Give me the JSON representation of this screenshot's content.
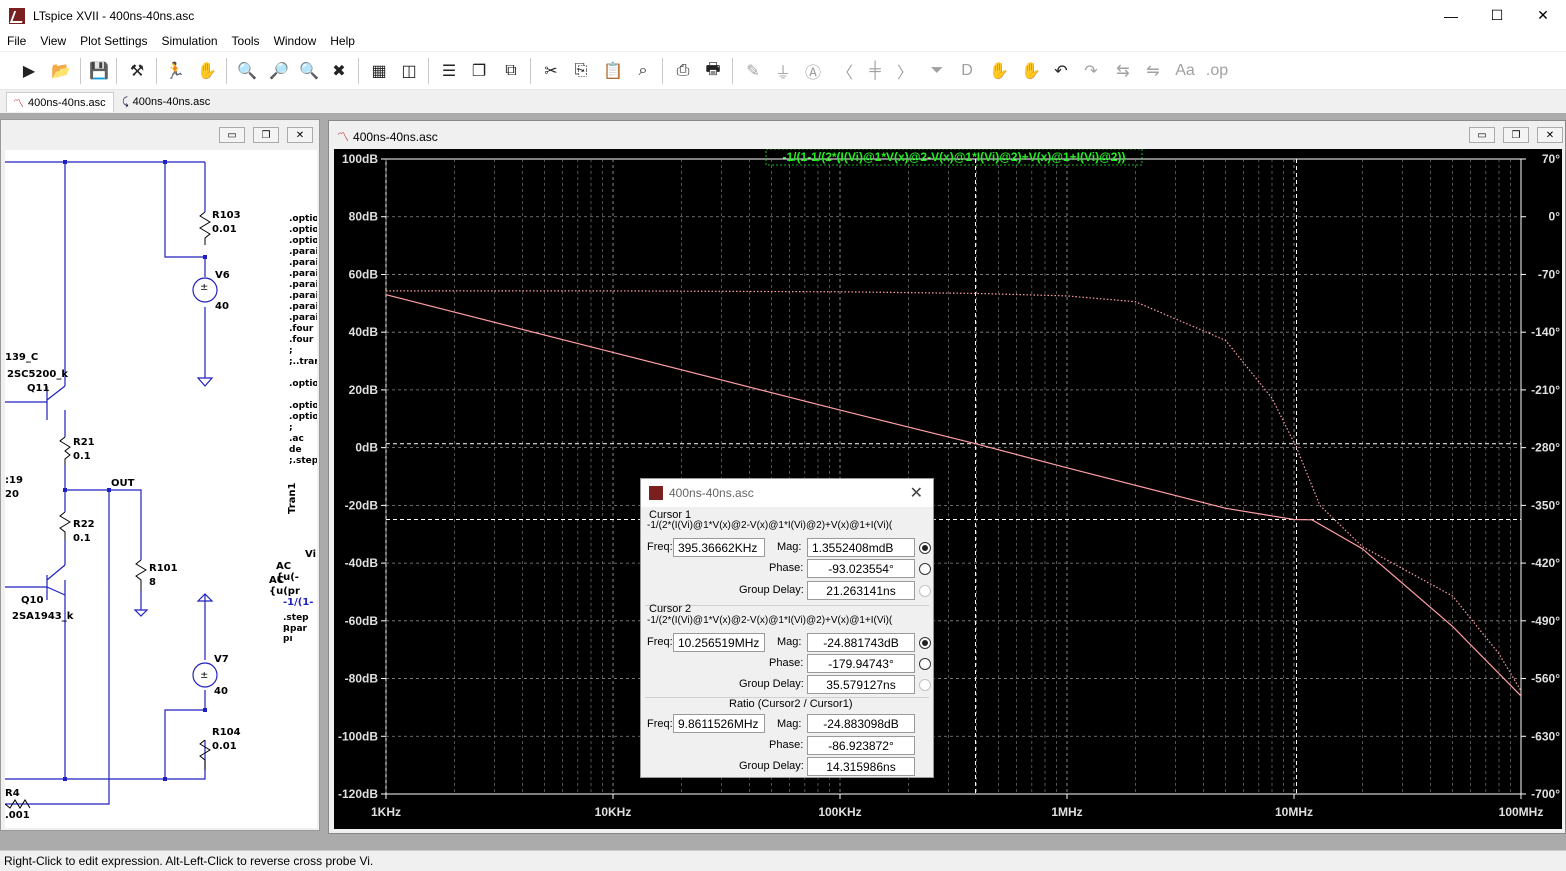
{
  "window": {
    "title": "LTspice XVII - 400ns-40ns.asc",
    "minimize": "—",
    "maximize": "☐",
    "close": "✕"
  },
  "menu": [
    "File",
    "View",
    "Plot Settings",
    "Simulation",
    "Tools",
    "Window",
    "Help"
  ],
  "tabs": [
    {
      "label": "400ns-40ns.asc"
    },
    {
      "label": "400ns-40ns.asc"
    }
  ],
  "schematic": {
    "labels": {
      "r103": "R103",
      "r103v": "0.01",
      "v6": "V6",
      "v6v": "40",
      "c139": "139_C",
      "q11t": "2SC5200_k",
      "q11": "Q11",
      "r21": "R21",
      "r21v": "0.1",
      "l19": ":19",
      "l20": "20",
      "out": "OUT",
      "r22": "R22",
      "r22v": "0.1",
      "r101": "R101",
      "r101v": "8",
      "q10": "Q10",
      "q10t": "2SA1943_k",
      "v7": "V7",
      "v7v": "40",
      "r104": "R104",
      "r104v": "0.01",
      "r4": "R4",
      "r4v": ".001",
      "tran1": "Tran1",
      "vi": "Vi",
      "ac1": "AC {u(-",
      "ac2": "AC {u(pr",
      "expr": "-1/(1-",
      "step": ".step p",
      "par": ";.par pı"
    },
    "directives": [
      ".optio",
      ".optio",
      ".optio",
      ".parai",
      ".parai",
      ".parai",
      ".parai",
      ".parai",
      ".parai",
      ".parai",
      ".four",
      ".four",
      ";",
      ";..trar",
      "",
      ".optio",
      "",
      ".optio",
      ".optio",
      ";",
      ".ac de",
      ";.step"
    ]
  },
  "plot": {
    "title": "400ns-40ns.asc",
    "trace_label": "-1/(1-1/(2*(I(Vi)@1*V(x)@2-V(x)@1*I(Vi)@2)+V(x)@1+I(Vi)@2))",
    "trace_color": "#ff9fa4",
    "chart_data": {
      "type": "line",
      "x_scale": "log",
      "x_ticks": [
        "1KHz",
        "10KHz",
        "100KHz",
        "1MHz",
        "10MHz",
        "100MHz"
      ],
      "y_left_ticks": [
        "100dB",
        "80dB",
        "60dB",
        "40dB",
        "20dB",
        "0dB",
        "-20dB",
        "-40dB",
        "-60dB",
        "-80dB",
        "-100dB",
        "-120dB"
      ],
      "y_right_ticks": [
        "70°",
        "0°",
        "-70°",
        "-140°",
        "-210°",
        "-280°",
        "-350°",
        "-420°",
        "-490°",
        "-560°",
        "-630°",
        "-700°"
      ],
      "ylim_left": [
        -120,
        100
      ],
      "ylim_right": [
        -700,
        70
      ],
      "grid": true,
      "series": [
        {
          "axis": "left",
          "style": "solid",
          "x": [
            1000,
            10000,
            100000,
            395366,
            1000000,
            5000000,
            10000000,
            12000000,
            20000000,
            50000000,
            100000000
          ],
          "y": [
            53,
            33,
            13,
            1.36,
            -7,
            -21,
            -24.9,
            -25,
            -35,
            -62,
            -86
          ]
        },
        {
          "axis": "right",
          "style": "dotted",
          "x": [
            1000,
            10000,
            100000,
            395366,
            1000000,
            2000000,
            5000000,
            8000000,
            10256519,
            13000000,
            20000000,
            50000000,
            80000000,
            100000000
          ],
          "y": [
            -90,
            -90,
            -91,
            -93,
            -96,
            -103,
            -150,
            -220,
            -280,
            -350,
            -400,
            -460,
            -530,
            -575
          ]
        }
      ],
      "cursors": [
        {
          "x": 395366,
          "y": 1.36
        },
        {
          "x": 10256519,
          "y": -24.88
        }
      ]
    }
  },
  "dialog": {
    "title": "400ns-40ns.asc",
    "cursor1": {
      "heading": "Cursor 1",
      "expr": "-1/(2*(I(Vi)@1*V(x)@2-V(x)@1*I(Vi)@2)+V(x)@1+I(Vi)(",
      "freq_label": "Freq:",
      "freq": "395.36662KHz",
      "mag_label": "Mag:",
      "mag": "1.3552408mdB",
      "phase_label": "Phase:",
      "phase": "-93.023554°",
      "gd_label": "Group Delay:",
      "gd": "21.263141ns"
    },
    "cursor2": {
      "heading": "Cursor 2",
      "expr": "-1/(2*(I(Vi)@1*V(x)@2-V(x)@1*I(Vi)@2)+V(x)@1+I(Vi)(",
      "freq_label": "Freq:",
      "freq": "10.256519MHz",
      "mag_label": "Mag:",
      "mag": "-24.881743dB",
      "phase_label": "Phase:",
      "phase": "-179.94743°",
      "gd_label": "Group Delay:",
      "gd": "35.579127ns"
    },
    "ratio": {
      "heading": "Ratio (Cursor2 / Cursor1)",
      "freq_label": "Freq:",
      "freq": "9.8611526MHz",
      "mag_label": "Mag:",
      "mag": "-24.883098dB",
      "phase_label": "Phase:",
      "phase": "-86.923872°",
      "gd_label": "Group Delay:",
      "gd": "14.315986ns"
    }
  },
  "status": "Right-Click to edit expression. Alt-Left-Click to reverse cross probe Vi."
}
